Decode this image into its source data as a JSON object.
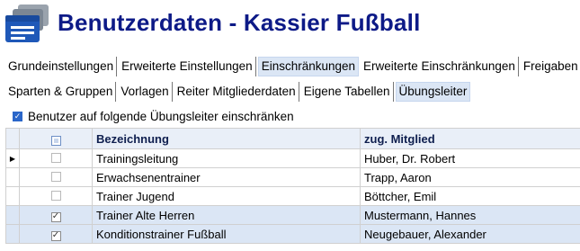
{
  "header": {
    "title": "Benutzerdaten - Kassier Fußball",
    "icon": "user-card-icon",
    "title_color": "#0d1a87"
  },
  "tabs_row1": [
    {
      "label": "Grundeinstellungen",
      "active": false
    },
    {
      "label": "Erweiterte Einstellungen",
      "active": false
    },
    {
      "label": "Einschränkungen",
      "active": true
    },
    {
      "label": "Erweiterte Einschränkungen",
      "active": false
    },
    {
      "label": "Freigaben",
      "active": false
    }
  ],
  "tabs_row2": [
    {
      "label": "Sparten & Gruppen",
      "active": false
    },
    {
      "label": "Vorlagen",
      "active": false
    },
    {
      "label": "Reiter Mitgliederdaten",
      "active": false
    },
    {
      "label": "Eigene Tabellen",
      "active": false
    },
    {
      "label": "Übungsleiter",
      "active": true
    }
  ],
  "restrict": {
    "label": "Benutzer auf folgende Übungsleiter einschränken",
    "checked": true
  },
  "table": {
    "columns": [
      "Bezeichnung",
      "zug. Mitglied"
    ],
    "rows": [
      {
        "name": "Trainingsleitung",
        "member": "Huber, Dr. Robert",
        "checked": false,
        "current": true
      },
      {
        "name": "Erwachsenentrainer",
        "member": "Trapp, Aaron",
        "checked": false,
        "current": false
      },
      {
        "name": "Trainer Jugend",
        "member": "Böttcher, Emil",
        "checked": false,
        "current": false
      },
      {
        "name": "Trainer Alte Herren",
        "member": "Mustermann, Hannes",
        "checked": true,
        "current": false
      },
      {
        "name": "Konditionstrainer Fußball",
        "member": "Neugebauer, Alexander",
        "checked": true,
        "current": false
      }
    ]
  },
  "colors": {
    "accent": "#2a66c9",
    "selected_row": "#dbe6f5",
    "header_bg": "#e9eff8"
  }
}
